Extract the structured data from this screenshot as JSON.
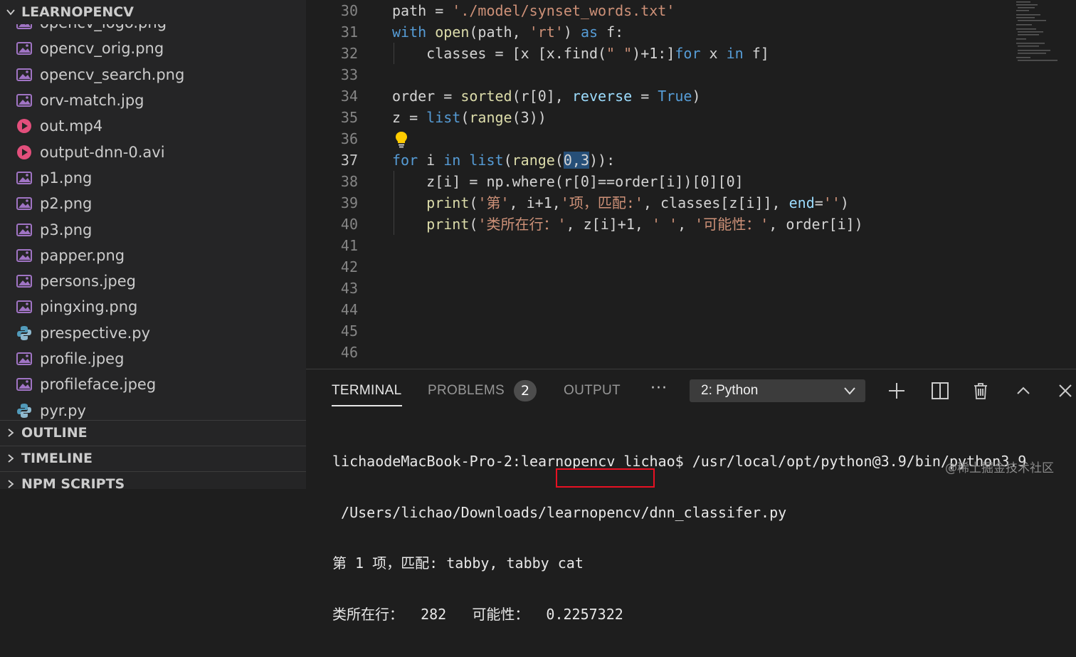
{
  "explorer": {
    "title": "LEARNOPENCV",
    "files": [
      {
        "name": "opencv_logo.png",
        "icon": "image-file-icon"
      },
      {
        "name": "opencv_orig.png",
        "icon": "image-file-icon"
      },
      {
        "name": "opencv_search.png",
        "icon": "image-file-icon"
      },
      {
        "name": "orv-match.jpg",
        "icon": "image-file-icon"
      },
      {
        "name": "out.mp4",
        "icon": "video-file-icon"
      },
      {
        "name": "output-dnn-0.avi",
        "icon": "video-file-icon"
      },
      {
        "name": "p1.png",
        "icon": "image-file-icon"
      },
      {
        "name": "p2.png",
        "icon": "image-file-icon"
      },
      {
        "name": "p3.png",
        "icon": "image-file-icon"
      },
      {
        "name": "papper.png",
        "icon": "image-file-icon"
      },
      {
        "name": "persons.jpeg",
        "icon": "image-file-icon"
      },
      {
        "name": "pingxing.png",
        "icon": "image-file-icon"
      },
      {
        "name": "prespective.py",
        "icon": "python-file-icon"
      },
      {
        "name": "profile.jpeg",
        "icon": "image-file-icon"
      },
      {
        "name": "profileface.jpeg",
        "icon": "image-file-icon"
      },
      {
        "name": "pyr.py",
        "icon": "python-file-icon"
      }
    ],
    "sections": {
      "outline": "OUTLINE",
      "timeline": "TIMELINE",
      "npm_scripts": "NPM SCRIPTS"
    }
  },
  "editor": {
    "active_line": 37,
    "lines": [
      {
        "n": "30",
        "t": [
          [
            "path = ",
            ""
          ],
          [
            "'./model/synset_words.txt'",
            "str"
          ]
        ]
      },
      {
        "n": "31",
        "t": [
          [
            "with",
            "kw"
          ],
          [
            " ",
            ""
          ],
          [
            "open",
            "fn"
          ],
          [
            "(path, ",
            ""
          ],
          [
            "'rt'",
            "str"
          ],
          [
            ") ",
            ""
          ],
          [
            "as",
            "kw"
          ],
          [
            " f:",
            ""
          ]
        ]
      },
      {
        "n": "32",
        "indent": true,
        "t": [
          [
            "    classes = [x [x.find(",
            ""
          ],
          [
            "\" \"",
            "str"
          ],
          [
            ")+1:]",
            ""
          ],
          [
            "for",
            "kw"
          ],
          [
            " x ",
            ""
          ],
          [
            "in",
            "kw"
          ],
          [
            " f]",
            ""
          ]
        ]
      },
      {
        "n": "33",
        "t": []
      },
      {
        "n": "34",
        "t": [
          [
            "order = ",
            ""
          ],
          [
            "sorted",
            "fn"
          ],
          [
            "(r[0], ",
            ""
          ],
          [
            "reverse",
            "par"
          ],
          [
            " = ",
            ""
          ],
          [
            "True",
            "kw"
          ],
          [
            ")",
            ""
          ]
        ]
      },
      {
        "n": "35",
        "t": [
          [
            "z = ",
            ""
          ],
          [
            "list",
            "kw"
          ],
          [
            "(",
            ""
          ],
          [
            "range",
            "fn"
          ],
          [
            "(3))",
            ""
          ]
        ]
      },
      {
        "n": "36",
        "t": [],
        "bulb": true
      },
      {
        "n": "37",
        "t": [
          [
            "for",
            "kw"
          ],
          [
            " i ",
            ""
          ],
          [
            "in",
            "kw"
          ],
          [
            " ",
            ""
          ],
          [
            "list",
            "kw"
          ],
          [
            "(",
            ""
          ],
          [
            "range",
            "fn"
          ],
          [
            "(",
            ""
          ],
          [
            "0,3",
            "sel"
          ],
          [
            "))",
            ""
          ],
          [
            ":",
            ""
          ]
        ]
      },
      {
        "n": "38",
        "indent": true,
        "t": [
          [
            "    z[i] = np.where(r[0]==order[i])[0][0]",
            ""
          ]
        ]
      },
      {
        "n": "39",
        "indent": true,
        "t": [
          [
            "    ",
            ""
          ],
          [
            "print",
            "fn"
          ],
          [
            "(",
            ""
          ],
          [
            "'第'",
            "str"
          ],
          [
            ", i+1,",
            ""
          ],
          [
            "'项，匹配:'",
            "str"
          ],
          [
            ", classes[z[i]], ",
            ""
          ],
          [
            "end",
            "par"
          ],
          [
            "=",
            ""
          ],
          [
            "''",
            "str"
          ],
          [
            ")",
            ""
          ]
        ]
      },
      {
        "n": "40",
        "indent": true,
        "t": [
          [
            "    ",
            ""
          ],
          [
            "print",
            "fn"
          ],
          [
            "(",
            ""
          ],
          [
            "'类所在行：'",
            "str"
          ],
          [
            ", z[i]+1, ",
            ""
          ],
          [
            "' '",
            "str"
          ],
          [
            ", ",
            ""
          ],
          [
            "'可能性：'",
            "str"
          ],
          [
            ", order[i])",
            ""
          ]
        ]
      },
      {
        "n": "41",
        "t": []
      },
      {
        "n": "42",
        "t": []
      },
      {
        "n": "43",
        "t": []
      },
      {
        "n": "44",
        "t": []
      },
      {
        "n": "45",
        "t": []
      },
      {
        "n": "46",
        "t": []
      }
    ]
  },
  "panel": {
    "tabs": {
      "terminal": "TERMINAL",
      "problems": "PROBLEMS",
      "output": "OUTPUT"
    },
    "problems_count": "2",
    "more": "···",
    "terminal_select": "2: Python",
    "terminal_lines": [
      "lichaodeMacBook-Pro-2:learnopencv lichao$ /usr/local/opt/python@3.9/bin/python3.9",
      " /Users/lichao/Downloads/learnopencv/dnn_classifer.py",
      "第 1 项，匹配: tabby, tabby cat",
      "类所在行：  282   可能性：  0.2257322"
    ],
    "watermark": "@稀土掘金技术社区"
  },
  "colors": {
    "keyword": "#569cd6",
    "function": "#dcdcaa",
    "string": "#ce9178",
    "highlight_box": "#e81123"
  }
}
